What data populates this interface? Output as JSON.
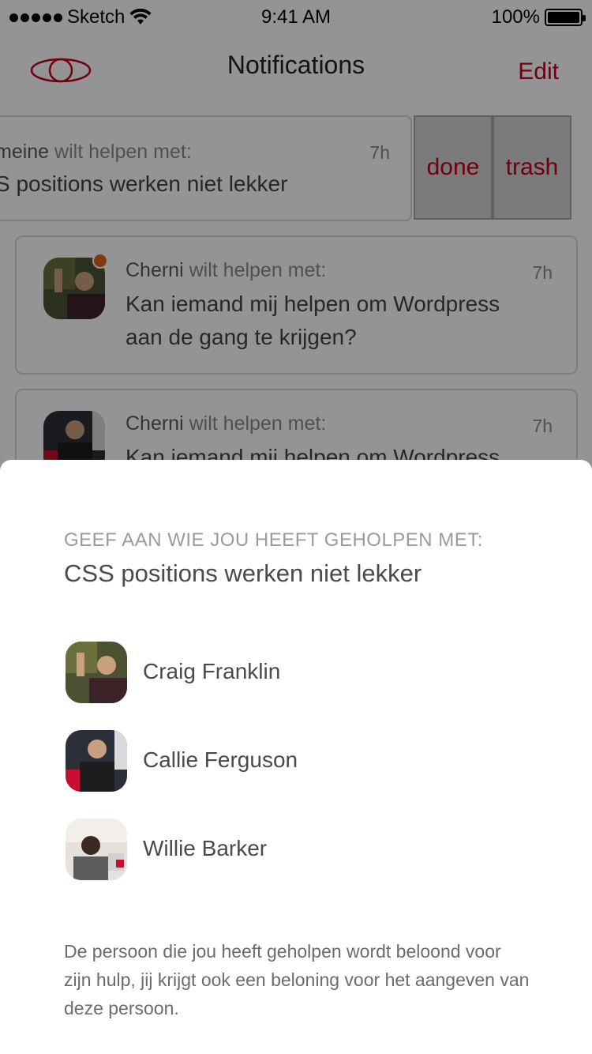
{
  "status_bar": {
    "carrier": "Sketch",
    "time": "9:41 AM",
    "battery": "100%"
  },
  "nav": {
    "title": "Notifications",
    "edit_label": "Edit"
  },
  "notifications": [
    {
      "name": "Jasmeine",
      "name_visible": "meine",
      "action_text": "wilt helpen met:",
      "time": "7h",
      "message_visible": "S positions werken niet lekker",
      "swiped": true,
      "actions": {
        "done_label": "done",
        "trash_label": "trash"
      }
    },
    {
      "name": "Cherni",
      "action_text": "wilt helpen met:",
      "time": "7h",
      "message_line1": "Kan iemand mij helpen om Wordpress",
      "message_line2": "aan de gang te krijgen?",
      "unread": true
    },
    {
      "name": "Cherni",
      "action_text": "wilt helpen met:",
      "time": "7h",
      "message_line1": "Kan iemand mij helpen om Wordpress"
    }
  ],
  "sheet": {
    "heading": "GEEF AAN WIE JOU HEEFT GEHOLPEN MET:",
    "subject": "CSS positions werken niet lekker",
    "helpers": [
      {
        "name": "Craig Franklin"
      },
      {
        "name": "Callie Ferguson"
      },
      {
        "name": "Willie Barker"
      }
    ],
    "footer": "De persoon die jou heeft geholpen wordt beloond voor zijn hulp, jij krijgt ook een beloning voor het aangeven van deze persoon."
  },
  "colors": {
    "accent": "#c2001b",
    "unread_dot": "#e0631f",
    "overlay": "rgba(0,0,0,0.42)"
  }
}
